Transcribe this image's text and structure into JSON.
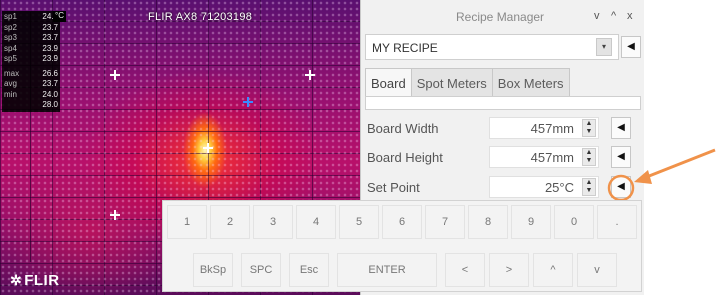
{
  "camera": {
    "title": "FLIR AX8 71203198",
    "logo_text": "FLIR",
    "unit": "°C",
    "readouts": [
      {
        "label": "sp1",
        "value": "24.2"
      },
      {
        "label": "sp2",
        "value": "23.7"
      },
      {
        "label": "sp3",
        "value": "23.7"
      },
      {
        "label": "sp4",
        "value": "23.9"
      },
      {
        "label": "sp5",
        "value": "23.9"
      }
    ],
    "box_readouts": [
      {
        "label": "max",
        "value": "26.6"
      },
      {
        "label": "avg",
        "value": "23.7"
      },
      {
        "label": "min",
        "value": "24.0"
      },
      {
        "label": "",
        "value": "28.0"
      }
    ]
  },
  "recipe_manager": {
    "title": "Recipe Manager",
    "window_buttons": [
      "v",
      "^",
      "x"
    ],
    "recipe_name": "MY RECIPE",
    "dropdown_glyph": "▾",
    "arrow_glyph": "◀",
    "tabs": [
      "Board",
      "Spot Meters",
      "Box Meters"
    ],
    "active_tab": "Board",
    "properties": [
      {
        "label": "Board Width",
        "value": "457mm"
      },
      {
        "label": "Board Height",
        "value": "457mm"
      },
      {
        "label": "Set Point",
        "value": "25°C"
      }
    ]
  },
  "keyboard": {
    "number_row": [
      "1",
      "2",
      "3",
      "4",
      "5",
      "6",
      "7",
      "8",
      "9",
      "0",
      "."
    ],
    "bottom_row": [
      "BkSp",
      "SPC",
      "Esc",
      "ENTER",
      "<",
      ">",
      "^",
      "v"
    ]
  },
  "colors": {
    "callout": "#f0924a",
    "panel_bg": "#f1f1f1"
  }
}
